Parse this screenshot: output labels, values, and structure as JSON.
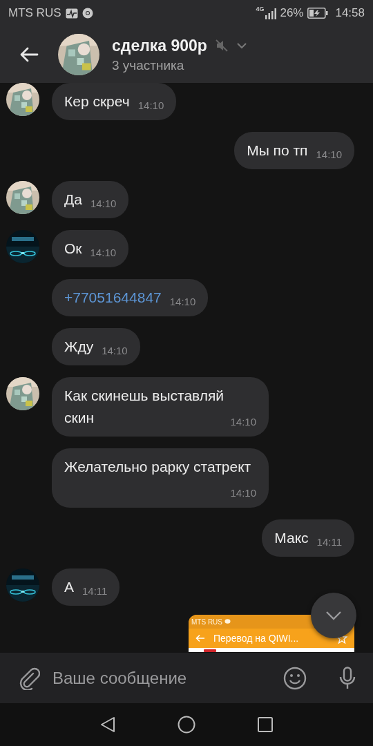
{
  "status_bar": {
    "carrier": "MTS RUS",
    "network": "4G",
    "battery": "26%",
    "time": "14:58"
  },
  "header": {
    "title": "сделка 900р",
    "subtitle": "3 участника",
    "muted": true
  },
  "messages": [
    {
      "kind": "text",
      "outgoing": false,
      "avatar": true,
      "text": "Кер скреч",
      "time": "14:10",
      "link": false
    },
    {
      "kind": "text",
      "outgoing": true,
      "text": "Мы по тп",
      "time": "14:10",
      "link": false
    },
    {
      "kind": "text",
      "outgoing": false,
      "avatar": true,
      "text": "Да",
      "time": "14:10",
      "link": false
    },
    {
      "kind": "text",
      "outgoing": false,
      "avatar": true,
      "text": "Ок",
      "time": "14:10",
      "link": false
    },
    {
      "kind": "text",
      "outgoing": false,
      "avatar": false,
      "text": "+77051644847",
      "time": "14:10",
      "link": true
    },
    {
      "kind": "text",
      "outgoing": false,
      "avatar": false,
      "text": "Жду",
      "time": "14:10",
      "link": false
    },
    {
      "kind": "text",
      "outgoing": false,
      "avatar": true,
      "text": "Как скинешь выставляй скин",
      "time": "14:10",
      "link": false
    },
    {
      "kind": "text",
      "outgoing": false,
      "avatar": false,
      "text": "Желательно рарку статрект",
      "time": "14:10",
      "link": false
    },
    {
      "kind": "text",
      "outgoing": true,
      "text": "Макс",
      "time": "14:11",
      "link": false
    },
    {
      "kind": "text",
      "outgoing": false,
      "avatar": true,
      "text": "А",
      "time": "14:11",
      "link": false
    },
    {
      "kind": "screenshot",
      "outgoing": true,
      "status_text": "MTS RUS",
      "title": "Перевод на QIWI..."
    }
  ],
  "composer": {
    "placeholder": "Ваше сообщение"
  }
}
